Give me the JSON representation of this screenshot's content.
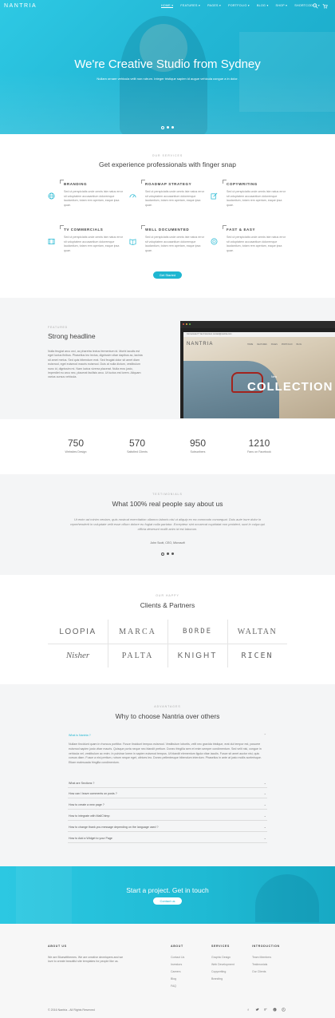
{
  "nav": {
    "logo": "NANTRIA",
    "items": [
      "HOME",
      "FEATURES",
      "PAGES",
      "PORTFOLIO",
      "BLOG",
      "SHOP",
      "SHORTCODES"
    ]
  },
  "hero": {
    "title": "We're Creative Studio from Sydney",
    "subtitle": "Nullam ornare vehicula velit non rutrum. Integer tristique sapien id augue vehicula congue a in dolor."
  },
  "services": {
    "eyebrow": "OUR SERVICES",
    "title": "Get experience professionals with finger snap",
    "items": [
      {
        "title": "BRANDING",
        "icon": "globe-icon",
        "text": "Sed ut perspiciatis unde omnis iste natus error sit voluptatem accusantium doloremque laudantium, totam rem aperiam, eaque ipsa quae."
      },
      {
        "title": "ROADMAP STRATEGY",
        "icon": "speedometer-icon",
        "text": "Sed ut perspiciatis unde omnis iste natus error sit voluptatem accusantium doloremque laudantium, totam rem aperiam, eaque ipsa quae."
      },
      {
        "title": "COPYWRITING",
        "icon": "pencil-icon",
        "text": "Sed ut perspiciatis unde omnis iste natus error sit voluptatem accusantium doloremque laudantium, totam rem aperiam, eaque ipsa quae."
      },
      {
        "title": "TV COMMERCIALS",
        "icon": "film-icon",
        "text": "Sed ut perspiciatis unde omnis iste natus error sit voluptatem accusantium doloremque laudantium, totam rem aperiam, eaque ipsa quae."
      },
      {
        "title": "WELL DOCUMENTED",
        "icon": "book-icon",
        "text": "Sed ut perspiciatis unde omnis iste natus error sit voluptatem accusantium doloremque laudantium, totam rem aperiam, eaque ipsa quae."
      },
      {
        "title": "FAST & EASY",
        "icon": "lifebuoy-icon",
        "text": "Sed ut perspiciatis unde omnis iste natus error sit voluptatem accusantium doloremque laudantium, totam rem aperiam, eaque ipsa quae."
      }
    ],
    "button": "Get Started"
  },
  "featured": {
    "eyebrow": "FEATURED",
    "title": "Strong headline",
    "text": "Nulla feugiat arcu orci, ac pharetra lectus fermentum id. Morbi iaculis est eget luctus finibus. Phasellus leo lectus, dignissim vitae dapibus ac, lacinia sit amet metus. Sed quis bibendum erat. Sed feugiat dolor sit amet diam euismod, eget euismod mauris euismod. Duis at nulla dictum, vestibulum nunc id, dignissim mi. Nam luctus viverra placerat. Nulla eros justo, imperdiet eu arcu nec, placerat facilisis arcu. Ut luctus est lorem. Aliquam varius cursus vehicula.",
    "mock": {
      "address": "Conversate IT Van Francisco     contact@nantria.com",
      "logo": "NANTRIA",
      "menu": [
        "HOME",
        "FEATURES",
        "PAGES",
        "PORTFOLIO",
        "BLOG"
      ],
      "badge": "New",
      "banner": "COLLECTION"
    }
  },
  "stats": [
    {
      "value": "750",
      "label": "Websites Design"
    },
    {
      "value": "570",
      "label": "Satisfied Clients"
    },
    {
      "value": "950",
      "label": "Subscribers"
    },
    {
      "value": "1210",
      "label": "Fans on Facebook"
    }
  ],
  "testimonials": {
    "eyebrow": "TESTIMONIALS",
    "title": "What 100% real people say about us",
    "quote": "Ut enim ad minim veniam, quis nostrud exercitation ullamco laboris nisi ut aliquip ex ea commodo consequat. Duis aute irure dolor in reprehenderit in voluptate velit esse cillum dolore eu fugiat nulla pariatur. Excepteur sint occaecat cupidatat non proident, sunt in culpa qui officia deserunt mollit anim id est laborum.",
    "author": "John Scott, CEO, Microsoft"
  },
  "clients": {
    "eyebrow": "OUR HAPPY",
    "title": "Clients & Partners",
    "logos": [
      "LOOPIA",
      "MARCA",
      "BORDE",
      "WALTAN",
      "Nisher",
      "PALTA",
      "KNIGHT",
      "RICEN"
    ]
  },
  "faq": {
    "eyebrow": "ADVANTAGES",
    "title": "Why to choose Nantria over others",
    "open_question": "What is Nantria ?",
    "answer": "Nullam tincidunt quam in rhoncus porttitor. Fusce tincidunt tempus euismod. Vestibulum lobortis, velit nec gravida tristique, erat dui tempor est, posuere euismod sapien justo vitae mauris. Quisque porta neque nec blandit pretium. Donec fringilla sem et enim semper condimentum. Sed velit nisi, congue in vehicula vel, vestibulum ac enim. In pulvinar lorem in sapien euismod tempus. Ut blandit elementum ligula vitae iaculis. Fusce sit amet auctor nisi, quis cursus diam. Fusce a nisi pretium, rutrum neque eget, ultrices leo. Donec pellentesque bibendum interdum. Phasellus in ante at justo mollis scelerisque. Etiam malesuada fringilla condimentum.",
    "questions": [
      "What are Sections ?",
      "How can I leave comments on posts ?",
      "How to create a new page ?",
      "How to integrate with MailChimp",
      "How to change thank you message depending on the language used ?",
      "How to Add a Widget to your Page"
    ]
  },
  "cta": {
    "title": "Start a project. Get in touch",
    "button": "Contact us"
  },
  "footer": {
    "about_title": "ABOUT US",
    "about_text": "We are Bluewitthemes. We are creative developers and we love to create beautiful site templates for people like us.",
    "columns": [
      {
        "title": "ABOUT",
        "links": [
          "Contact Us",
          "Investors",
          "Careers",
          "Blog",
          "FAQ"
        ]
      },
      {
        "title": "SERVICES",
        "links": [
          "Graphic Design",
          "Web Development",
          "Copywriting",
          "Branding"
        ]
      },
      {
        "title": "INTRODUCTION",
        "links": [
          "Team Members",
          "Testimonials",
          "Our Clients"
        ]
      }
    ],
    "copyright": "© 2016 Nantria - All Rights Reserved",
    "social": [
      "facebook-icon",
      "twitter-icon",
      "google-plus-icon",
      "pinterest-icon",
      "dribbble-icon"
    ]
  }
}
